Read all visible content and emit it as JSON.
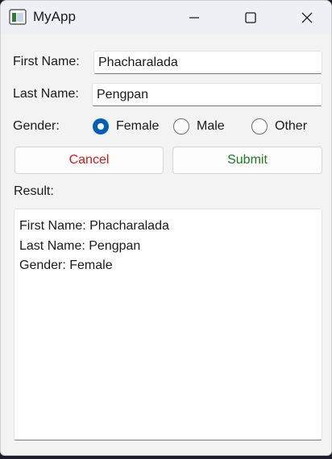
{
  "window": {
    "title": "MyApp",
    "icons": {
      "app": "app-window-icon",
      "minimize": "minimize-icon",
      "maximize": "maximize-icon",
      "close": "close-icon"
    }
  },
  "form": {
    "first_name": {
      "label": "First Name:",
      "value": "Phacharalada"
    },
    "last_name": {
      "label": "Last Name:",
      "value": "Pengpan"
    },
    "gender": {
      "label": "Gender:",
      "options": [
        {
          "label": "Female",
          "selected": true
        },
        {
          "label": "Male",
          "selected": false
        },
        {
          "label": "Other",
          "selected": false
        }
      ]
    }
  },
  "buttons": {
    "cancel": {
      "label": "Cancel",
      "color": "#d11a1a"
    },
    "submit": {
      "label": "Submit",
      "color": "#1f7a1f"
    }
  },
  "result": {
    "label": "Result:",
    "lines": [
      "First Name: Phacharalada",
      "Last Name: Pengpan",
      "Gender: Female"
    ]
  },
  "colors": {
    "accent": "#005fb8"
  }
}
